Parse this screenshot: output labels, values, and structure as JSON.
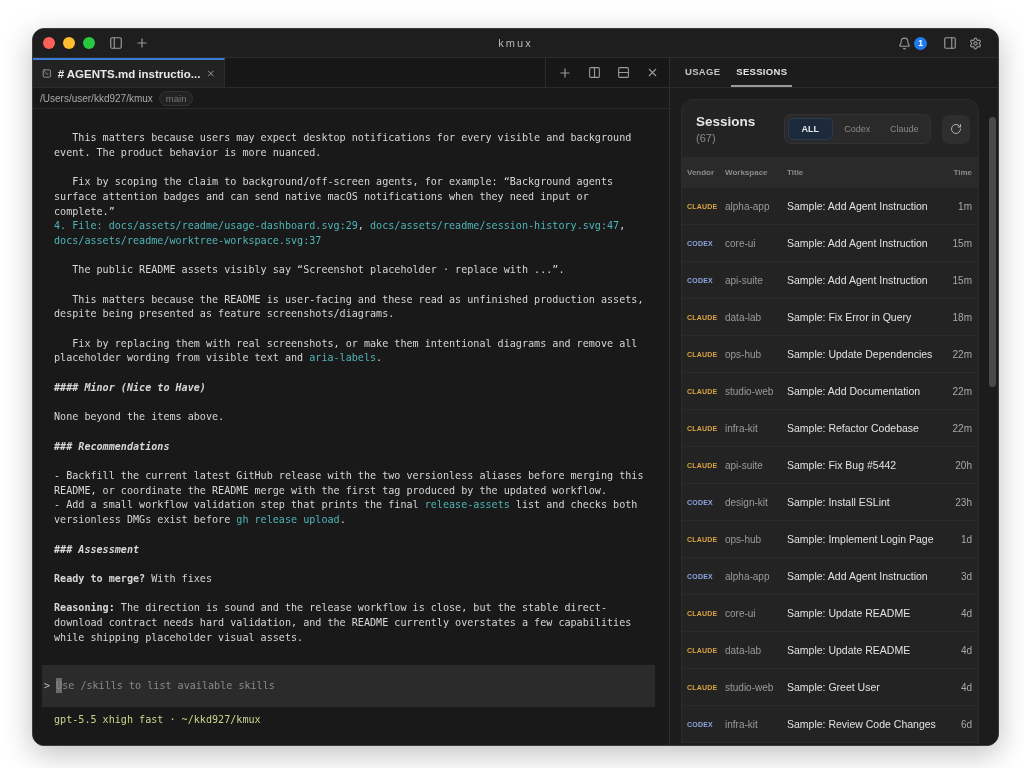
{
  "window": {
    "title": "kmux",
    "notification_count": "1"
  },
  "terminal": {
    "tab": {
      "title": "# AGENTS.md instructio...",
      "selected": true
    },
    "path": "/Users/user/kkd927/kmux",
    "branch": "main",
    "blocks": [
      [
        {
          "kind": "text",
          "parts": [
            {
              "kind": "text",
              "text": "   This matters because users may expect desktop notifications for every visible and background event. The product behavior is more nuanced."
            }
          ]
        }
      ],
      [
        {
          "kind": "text",
          "parts": [
            {
              "kind": "text",
              "text": "   Fix by scoping the claim to background/off-screen agents, for example: “Background agents surface attention badges and can send native macOS notifications when they need input or complete.”"
            }
          ]
        },
        {
          "kind": "text",
          "parts": [
            {
              "kind": "accent",
              "text": "4. File: "
            },
            {
              "kind": "link",
              "text": "docs/assets/readme/usage-dashboard.svg:29"
            },
            {
              "kind": "text",
              "text": ", "
            },
            {
              "kind": "link",
              "text": "docs/assets/readme/session-history.svg:47"
            },
            {
              "kind": "text",
              "text": ", "
            },
            {
              "kind": "link",
              "text": "docs/assets/readme/worktree-workspace.svg:37"
            }
          ]
        }
      ],
      [
        {
          "kind": "text",
          "parts": [
            {
              "kind": "text",
              "text": "   The public README assets visibly say “Screenshot placeholder · replace with ...”."
            }
          ]
        }
      ],
      [
        {
          "kind": "text",
          "parts": [
            {
              "kind": "text",
              "text": "   This matters because the README is user-facing and these read as unfinished production assets, despite being presented as feature screenshots/diagrams."
            }
          ]
        }
      ],
      [
        {
          "kind": "text",
          "parts": [
            {
              "kind": "text",
              "text": "   Fix by replacing them with real screenshots, or make them intentional diagrams and remove all placeholder wording from visible text and "
            },
            {
              "kind": "code",
              "text": "aria-labels"
            },
            {
              "kind": "text",
              "text": "."
            }
          ]
        }
      ],
      [
        {
          "kind": "heading",
          "parts": [
            {
              "kind": "text",
              "text": "#### Minor (Nice to Have)"
            }
          ]
        }
      ],
      [
        {
          "kind": "text",
          "parts": [
            {
              "kind": "text",
              "text": "None beyond the items above."
            }
          ]
        }
      ],
      [
        {
          "kind": "heading",
          "parts": [
            {
              "kind": "text",
              "text": "### Recommendations"
            }
          ]
        }
      ],
      [
        {
          "kind": "text",
          "parts": [
            {
              "kind": "text",
              "text": "- Backfill the current latest GitHub release with the two versionless aliases before merging this README, or coordinate the README merge with the first tag produced by the updated workflow."
            }
          ]
        },
        {
          "kind": "text",
          "parts": [
            {
              "kind": "text",
              "text": "- Add a small workflow validation step that prints the final "
            },
            {
              "kind": "code",
              "text": "release-assets"
            },
            {
              "kind": "text",
              "text": " list and checks both versionless DMGs exist before "
            },
            {
              "kind": "code",
              "text": "gh release upload"
            },
            {
              "kind": "text",
              "text": "."
            }
          ]
        }
      ],
      [
        {
          "kind": "heading",
          "parts": [
            {
              "kind": "text",
              "text": "### Assessment"
            }
          ]
        }
      ],
      [
        {
          "kind": "text",
          "parts": [
            {
              "kind": "bold",
              "text": "Ready to merge?"
            },
            {
              "kind": "text",
              "text": " With fixes"
            }
          ]
        }
      ],
      [
        {
          "kind": "text",
          "parts": [
            {
              "kind": "bold",
              "text": "Reasoning:"
            },
            {
              "kind": "text",
              "text": " The direction is sound and the release workflow is close, but the stable direct-download contract needs hard validation, and the README currently overstates a few capabilities while shipping placeholder visual assets."
            }
          ]
        }
      ]
    ],
    "prompt": {
      "symbol": ">",
      "placeholder": "Use /skills to list available skills"
    },
    "status": "gpt-5.5 xhigh fast · ~/kkd927/kmux"
  },
  "panel": {
    "tabs": [
      {
        "label": "USAGE",
        "selected": false
      },
      {
        "label": "SESSIONS",
        "selected": true
      }
    ],
    "sessions": {
      "title": "Sessions",
      "count": "(67)",
      "filters": [
        {
          "label": "ALL",
          "selected": true
        },
        {
          "label": "Codex",
          "selected": false
        },
        {
          "label": "Claude",
          "selected": false
        }
      ],
      "columns": [
        "Vendor",
        "Workspace",
        "Title",
        "Time"
      ],
      "rows": [
        {
          "vendor": "CLAUDE",
          "color": "#d9a441",
          "workspace": "alpha-app",
          "title": "Sample: Add Agent Instruction",
          "time": "1m"
        },
        {
          "vendor": "CODEX",
          "color": "#8ea4e0",
          "workspace": "core-ui",
          "title": "Sample: Add Agent Instruction",
          "time": "15m"
        },
        {
          "vendor": "CODEX",
          "color": "#8ea4e0",
          "workspace": "api-suite",
          "title": "Sample: Add Agent Instruction",
          "time": "15m"
        },
        {
          "vendor": "CLAUDE",
          "color": "#d9a441",
          "workspace": "data-lab",
          "title": "Sample: Fix Error in Query",
          "time": "18m"
        },
        {
          "vendor": "CLAUDE",
          "color": "#d9a441",
          "workspace": "ops-hub",
          "title": "Sample: Update Dependencies",
          "time": "22m"
        },
        {
          "vendor": "CLAUDE",
          "color": "#d9a441",
          "workspace": "studio-web",
          "title": "Sample: Add Documentation",
          "time": "22m"
        },
        {
          "vendor": "CLAUDE",
          "color": "#d9a441",
          "workspace": "infra-kit",
          "title": "Sample: Refactor Codebase",
          "time": "22m"
        },
        {
          "vendor": "CLAUDE",
          "color": "#d9a441",
          "workspace": "api-suite",
          "title": "Sample: Fix Bug #5442",
          "time": "20h"
        },
        {
          "vendor": "CODEX",
          "color": "#8ea4e0",
          "workspace": "design-kit",
          "title": "Sample: Install ESLint",
          "time": "23h"
        },
        {
          "vendor": "CLAUDE",
          "color": "#d9a441",
          "workspace": "ops-hub",
          "title": "Sample: Implement Login Page",
          "time": "1d"
        },
        {
          "vendor": "CODEX",
          "color": "#8ea4e0",
          "workspace": "alpha-app",
          "title": "Sample: Add Agent Instruction",
          "time": "3d"
        },
        {
          "vendor": "CLAUDE",
          "color": "#d9a441",
          "workspace": "core-ui",
          "title": "Sample: Update README",
          "time": "4d"
        },
        {
          "vendor": "CLAUDE",
          "color": "#d9a441",
          "workspace": "data-lab",
          "title": "Sample: Update README",
          "time": "4d"
        },
        {
          "vendor": "CLAUDE",
          "color": "#d9a441",
          "workspace": "studio-web",
          "title": "Sample: Greet User",
          "time": "4d"
        },
        {
          "vendor": "CODEX",
          "color": "#8ea4e0",
          "workspace": "infra-kit",
          "title": "Sample: Review Code Changes",
          "time": "6d"
        }
      ]
    }
  }
}
